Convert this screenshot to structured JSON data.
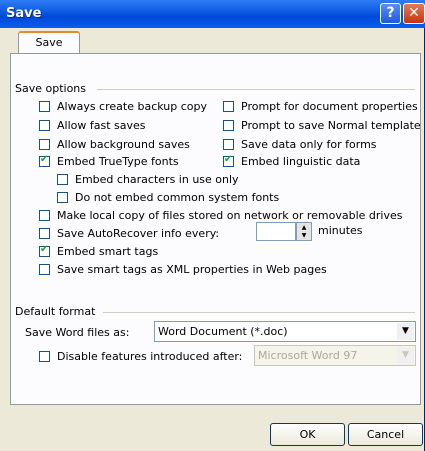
{
  "window": {
    "title": "Save",
    "help_glyph": "?",
    "close_glyph": "✕"
  },
  "tabs": [
    {
      "label": "Save"
    }
  ],
  "save_options": {
    "heading": "Save options",
    "always_backup": {
      "label": "Always create backup copy",
      "checked": false
    },
    "allow_fast_saves": {
      "label": "Allow fast saves",
      "checked": false
    },
    "allow_background": {
      "label": "Allow background saves",
      "checked": false
    },
    "embed_truetype": {
      "label": "Embed TrueType fonts",
      "checked": true
    },
    "embed_chars_only": {
      "label": "Embed characters in use only",
      "checked": false
    },
    "no_embed_common": {
      "label": "Do not embed common system fonts",
      "checked": false
    },
    "prompt_doc_props": {
      "label": "Prompt for document properties",
      "checked": false
    },
    "prompt_normal": {
      "label": "Prompt to save Normal template",
      "checked": false
    },
    "save_data_forms": {
      "label": "Save data only for forms",
      "checked": false
    },
    "embed_linguistic": {
      "label": "Embed linguistic data",
      "checked": true
    },
    "local_copy": {
      "label": "Make local copy of files stored on network or removable drives",
      "checked": false
    },
    "autorecover": {
      "label": "Save AutoRecover info every:",
      "checked": false,
      "value": "",
      "unit": "minutes"
    },
    "smart_tags": {
      "label": "Embed smart tags",
      "checked": true
    },
    "smart_tags_xml": {
      "label": "Save smart tags as XML properties in Web pages",
      "checked": false
    }
  },
  "default_format": {
    "heading": "Default format",
    "save_as_label": "Save Word files as:",
    "save_as_value": "Word Document (*.doc)",
    "disable_features": {
      "label": "Disable features introduced after:",
      "checked": false
    },
    "disable_value": "Microsoft Word 97"
  },
  "buttons": {
    "ok": "OK",
    "cancel": "Cancel"
  },
  "colors": {
    "titlebar": "#0a58e0",
    "dialog_bg": "#ece9d8",
    "panel_bg": "#fcfcfe",
    "check": "#21a121",
    "tab_accent": "#e68b2c"
  }
}
